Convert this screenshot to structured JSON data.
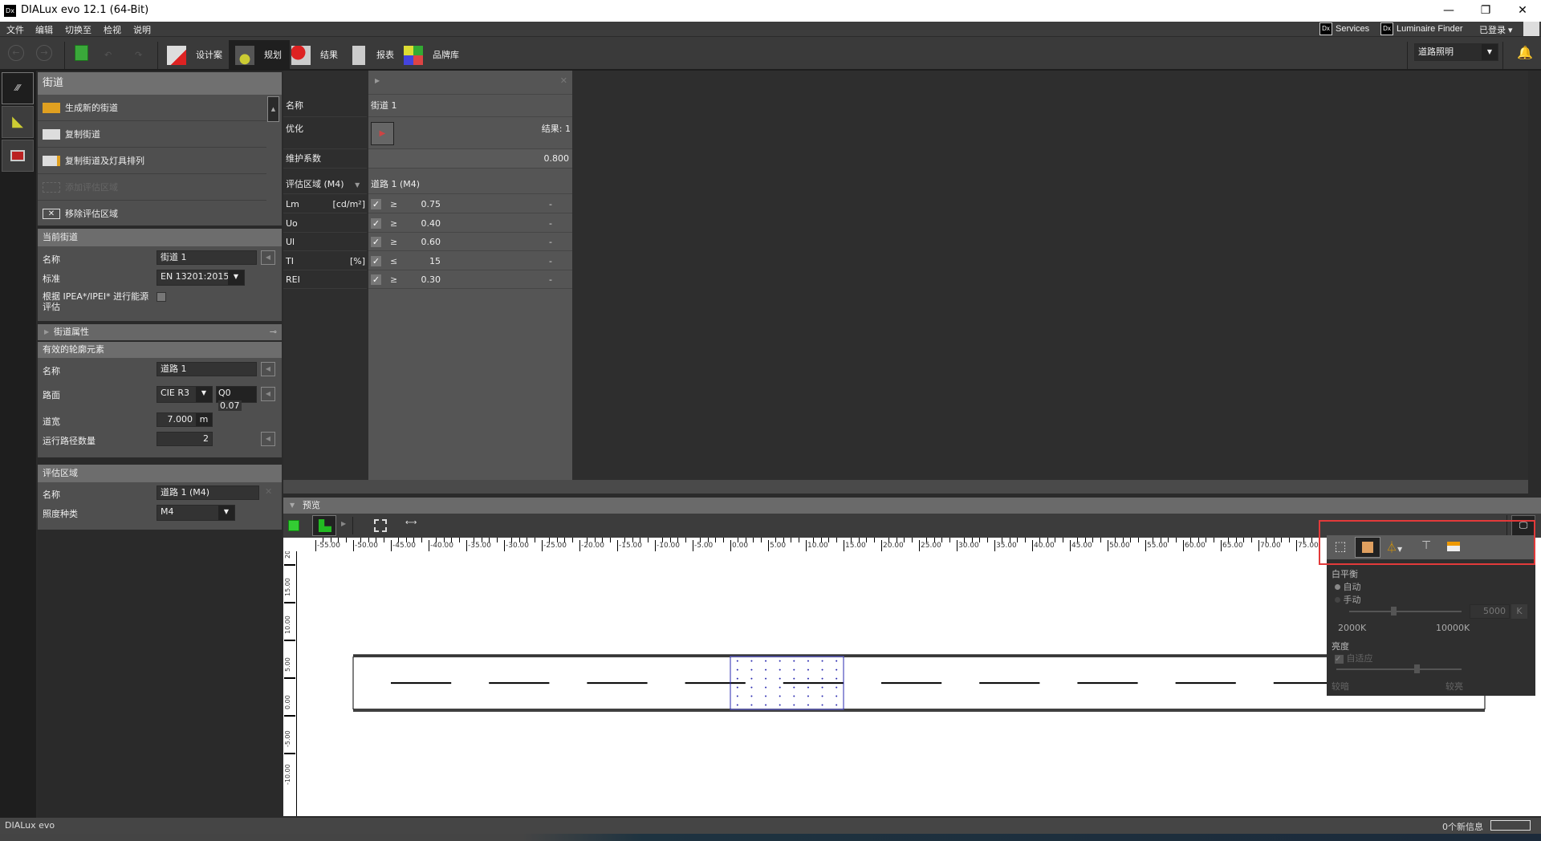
{
  "window": {
    "logo": "Dx",
    "title": "DIALux evo 12.1  (64-Bit)",
    "minimize": "—",
    "restore": "❐",
    "close": "✕"
  },
  "menu": [
    "文件",
    "编辑",
    "切换至",
    "检视",
    "说明"
  ],
  "top_right": {
    "services": "Services",
    "finder": "Luminaire Finder",
    "login": "已登录 ▾",
    "dx": "Dx"
  },
  "toolbar": {
    "tabs": [
      {
        "label": "设计案",
        "icon": "design-icon"
      },
      {
        "label": "规划",
        "icon": "planning-icon",
        "active": true
      },
      {
        "label": "结果",
        "icon": "results-icon"
      },
      {
        "label": "报表",
        "icon": "report-icon"
      },
      {
        "label": "品牌库",
        "icon": "catalog-icon"
      }
    ],
    "mode_select": "道路照明"
  },
  "left_panel": {
    "title": "街道",
    "actions": [
      {
        "label": "生成新的街道",
        "enabled": true
      },
      {
        "label": "复制街道",
        "enabled": true
      },
      {
        "label": "复制街道及灯具排列",
        "enabled": true
      },
      {
        "label": "添加评估区域",
        "enabled": false
      },
      {
        "label": "移除评估区域",
        "enabled": true
      }
    ],
    "current_street": {
      "title": "当前街道",
      "name_label": "名称",
      "name_value": "街道 1",
      "standard_label": "标准",
      "standard_value": "EN 13201:2015",
      "energy_label": "根据 IPEA*/IPEI* 进行能源评估",
      "energy_checked": false
    },
    "street_props": "街道属性",
    "profile": {
      "title": "有效的轮廓元素",
      "name_label": "名称",
      "name_value": "道路 1",
      "surface_label": "路面",
      "surface_value": "CIE R3",
      "q0_label": "Q0",
      "q0_value": "0.07",
      "width_label": "道宽",
      "width_value": "7.000",
      "width_unit": "m",
      "lanes_label": "运行路径数量",
      "lanes_value": "2"
    },
    "eval": {
      "title": "评估区域",
      "name_label": "名称",
      "name_value": "道路 1 (M4)",
      "class_label": "照度种类",
      "class_value": "M4"
    }
  },
  "props": {
    "name_label": "名称",
    "name_value": "街道 1",
    "optimize_label": "优化",
    "result": "结果: 1",
    "mf_label": "维护系数",
    "mf_value": "0.800",
    "eval_label": "评估区域 (M4)",
    "eval_value": "道路 1 (M4)",
    "rows": [
      {
        "label": "Lm",
        "unit": "[cd/m²]",
        "op": "≥",
        "value": "0.75",
        "result": "-"
      },
      {
        "label": "Uo",
        "unit": "",
        "op": "≥",
        "value": "0.40",
        "result": "-"
      },
      {
        "label": "Ul",
        "unit": "",
        "op": "≥",
        "value": "0.60",
        "result": "-"
      },
      {
        "label": "TI",
        "unit": "[%]",
        "op": "≤",
        "value": "15",
        "result": "-"
      },
      {
        "label": "REI",
        "unit": "",
        "op": "≥",
        "value": "0.30",
        "result": "-"
      }
    ]
  },
  "preview": {
    "title": "预览",
    "x_ticks": [
      "-55.00",
      "-50.00",
      "-45.00",
      "-40.00",
      "-35.00",
      "-30.00",
      "-25.00",
      "-20.00",
      "-15.00",
      "-10.00",
      "-5.00",
      "0.00",
      "5.00",
      "10.00",
      "15.00",
      "20.00",
      "25.00",
      "30.00",
      "35.00",
      "40.00",
      "45.00",
      "50.00",
      "55.00",
      "60.00",
      "65.00",
      "70.00",
      "75.00"
    ],
    "y_ticks": [
      "20",
      "15.00",
      "10.00",
      "5.00",
      "0.00",
      "-5.00",
      "-10.00"
    ],
    "road": {
      "x_from": -50,
      "x_to": 100,
      "y_from": 0,
      "y_to": 7
    },
    "eval_field": {
      "x_from": 0,
      "x_to": 15
    },
    "accent": "#2a2ab0"
  },
  "popup": {
    "white_balance": "白平衡",
    "auto": "自动",
    "manual": "手动",
    "kelvin": "5000",
    "kelvin_unit": "K",
    "min_k": "2000K",
    "max_k": "10000K",
    "wb_level": 0.37,
    "brightness": "亮度",
    "adaptive": "自适应",
    "darker": "较暗",
    "brighter": "较亮",
    "brightness_level": 0.62,
    "highlight_color": "#e23a3a"
  },
  "status": {
    "app": "DIALux evo",
    "messages": "0个新信息"
  }
}
